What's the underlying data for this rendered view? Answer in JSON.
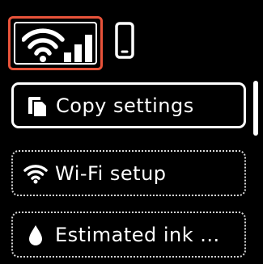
{
  "status": {
    "signal_icon": "wifi-signal-bars-icon",
    "device_icon": "smartphone-icon",
    "highlight_color": "#e8533a"
  },
  "menu": {
    "items": [
      {
        "label": "Copy settings",
        "icon": "copy-icon",
        "selected": true
      },
      {
        "label": "Wi-Fi setup",
        "icon": "wifi-icon",
        "selected": false
      },
      {
        "label": "Estimated ink ...",
        "icon": "ink-drop-icon",
        "selected": false
      }
    ]
  }
}
